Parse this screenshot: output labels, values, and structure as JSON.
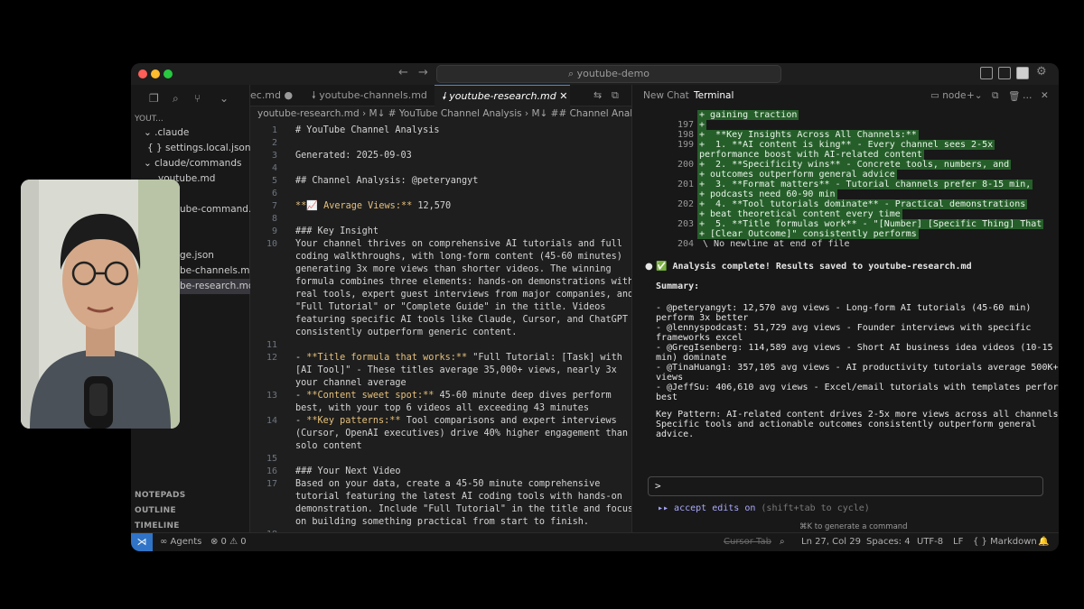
{
  "titlebar": {
    "search_placeholder": "⌕ youtube-demo"
  },
  "sidebar": {
    "root": "YOUT...",
    "items": [
      {
        "label": "⌄ .claude"
      },
      {
        "label": "{ } settings.local.json"
      },
      {
        "label": "⌄ claude/commands"
      },
      {
        "label": "youtube.md"
      },
      {
        "label": "ube-command..."
      },
      {
        "label": "ge.json"
      },
      {
        "label": "be-channels.md"
      },
      {
        "label": "be-research.md"
      }
    ],
    "sections": [
      "NOTEPADS",
      "OUTLINE",
      "TIMELINE"
    ]
  },
  "editor": {
    "tabs": [
      {
        "label": "ec.md"
      },
      {
        "label": "youtube-channels.md"
      },
      {
        "label": "youtube-research.md"
      }
    ],
    "breadcrumb": "youtube-research.md  ›  M↓ # YouTube Channel Analysis  ›  M↓ ## Channel Analysis: @",
    "lines": [
      {
        "n": "1",
        "text": "# YouTube Channel Analysis"
      },
      {
        "n": "2",
        "text": ""
      },
      {
        "n": "3",
        "text": "Generated: 2025-09-03"
      },
      {
        "n": "4",
        "text": ""
      },
      {
        "n": "5",
        "text": "## Channel Analysis: @peteryangyt"
      },
      {
        "n": "6",
        "text": ""
      },
      {
        "n": "7",
        "text": "**📈 Average Views:** 12,570"
      },
      {
        "n": "8",
        "text": ""
      },
      {
        "n": "9",
        "text": "### Key Insight"
      },
      {
        "n": "10",
        "text": "Your channel thrives on comprehensive AI tutorials and full"
      },
      {
        "n": "",
        "text": "coding walkthroughs, with long-form content (45-60 minutes)"
      },
      {
        "n": "",
        "text": "generating 3x more views than shorter videos. The winning"
      },
      {
        "n": "",
        "text": "formula combines three elements: hands-on demonstrations with"
      },
      {
        "n": "",
        "text": "real tools, expert guest interviews from major companies, and"
      },
      {
        "n": "",
        "text": "\"Full Tutorial\" or \"Complete Guide\" in the title. Videos"
      },
      {
        "n": "",
        "text": "featuring specific AI tools like Claude, Cursor, and ChatGPT"
      },
      {
        "n": "",
        "text": "consistently outperform generic content."
      },
      {
        "n": "11",
        "text": ""
      },
      {
        "n": "12",
        "text": "- **Title formula that works:** \"Full Tutorial: [Task] with"
      },
      {
        "n": "",
        "text": "[AI Tool]\" - These titles average 35,000+ views, nearly 3x"
      },
      {
        "n": "",
        "text": "your channel average"
      },
      {
        "n": "13",
        "text": "- **Content sweet spot:** 45-60 minute deep dives perform"
      },
      {
        "n": "",
        "text": "best, with your top 6 videos all exceeding 43 minutes"
      },
      {
        "n": "14",
        "text": "- **Key patterns:** Tool comparisons and expert interviews"
      },
      {
        "n": "",
        "text": "(Cursor, OpenAI executives) drive 40% higher engagement than"
      },
      {
        "n": "",
        "text": "solo content"
      },
      {
        "n": "15",
        "text": ""
      },
      {
        "n": "16",
        "text": "### Your Next Video"
      },
      {
        "n": "17",
        "text": "Based on your data, create a 45-50 minute comprehensive"
      },
      {
        "n": "",
        "text": "tutorial featuring the latest AI coding tools with hands-on"
      },
      {
        "n": "",
        "text": "demonstration. Include \"Full Tutorial\" in the title and focus"
      },
      {
        "n": "",
        "text": "on building something practical from start to finish."
      },
      {
        "n": "18",
        "text": ""
      }
    ]
  },
  "terminal": {
    "tabs": [
      "New Chat",
      "Terminal"
    ],
    "shell": "node",
    "diff": [
      {
        "n": "",
        "text": "+ gaining traction"
      },
      {
        "n": "197",
        "text": "+"
      },
      {
        "n": "198",
        "text": "+  **Key Insights Across All Channels:**"
      },
      {
        "n": "199",
        "text": "+  1. **AI content is king** - Every channel sees 2-5x"
      },
      {
        "n": "",
        "text": "performance boost with AI-related content"
      },
      {
        "n": "200",
        "text": "+  2. **Specificity wins** - Concrete tools, numbers, and"
      },
      {
        "n": "",
        "text": "+ outcomes outperform general advice"
      },
      {
        "n": "201",
        "text": "+  3. **Format matters** - Tutorial channels prefer 8-15 min,"
      },
      {
        "n": "",
        "text": "+ podcasts need 60-90 min"
      },
      {
        "n": "202",
        "text": "+  4. **Tool tutorials dominate** - Practical demonstrations"
      },
      {
        "n": "",
        "text": "+ beat theoretical content every time"
      },
      {
        "n": "203",
        "text": "+  5. **Title formulas work** - \"[Number] [Specific Thing] That"
      },
      {
        "n": "",
        "text": "+ [Clear Outcome]\" consistently performs"
      },
      {
        "n": "204",
        "text": " \\ No newline at end of file"
      }
    ],
    "complete": "✅ Analysis complete! Results saved to youtube-research.md",
    "summary_title": "Summary:",
    "summary": [
      "- @peteryangyt: 12,570 avg views - Long-form AI tutorials (45-60 min)",
      "perform 3x better",
      "- @lennyspodcast: 51,729 avg views - Founder interviews with specific",
      "frameworks excel",
      "- @GregIsenberg: 114,589 avg views - Short AI business idea videos (10-15",
      "min) dominate",
      "- @TinaHuang1: 357,105 avg views - AI productivity tutorials average 500K+",
      "views",
      "- @JeffSu: 406,610 avg views - Excel/email tutorials with templates perform",
      "best"
    ],
    "pattern": [
      "Key Pattern: AI-related content drives 2-5x more views across all channels.",
      "Specific tools and actionable outcomes consistently outperform general",
      "advice."
    ],
    "prompt": ">",
    "accept": "▸▸ accept edits on",
    "accept_hint": "(shift+tab to cycle)",
    "gen_cmd": "⌘K to generate a command"
  },
  "statusbar": {
    "agents": "∞ Agents",
    "problems": "⊗ 0 ⚠ 0",
    "cursor_tab": "Cursor Tab",
    "position": "Ln 27, Col 29",
    "spaces": "Spaces: 4",
    "encoding": "UTF-8",
    "eol": "LF",
    "language": "{ } Markdown"
  }
}
